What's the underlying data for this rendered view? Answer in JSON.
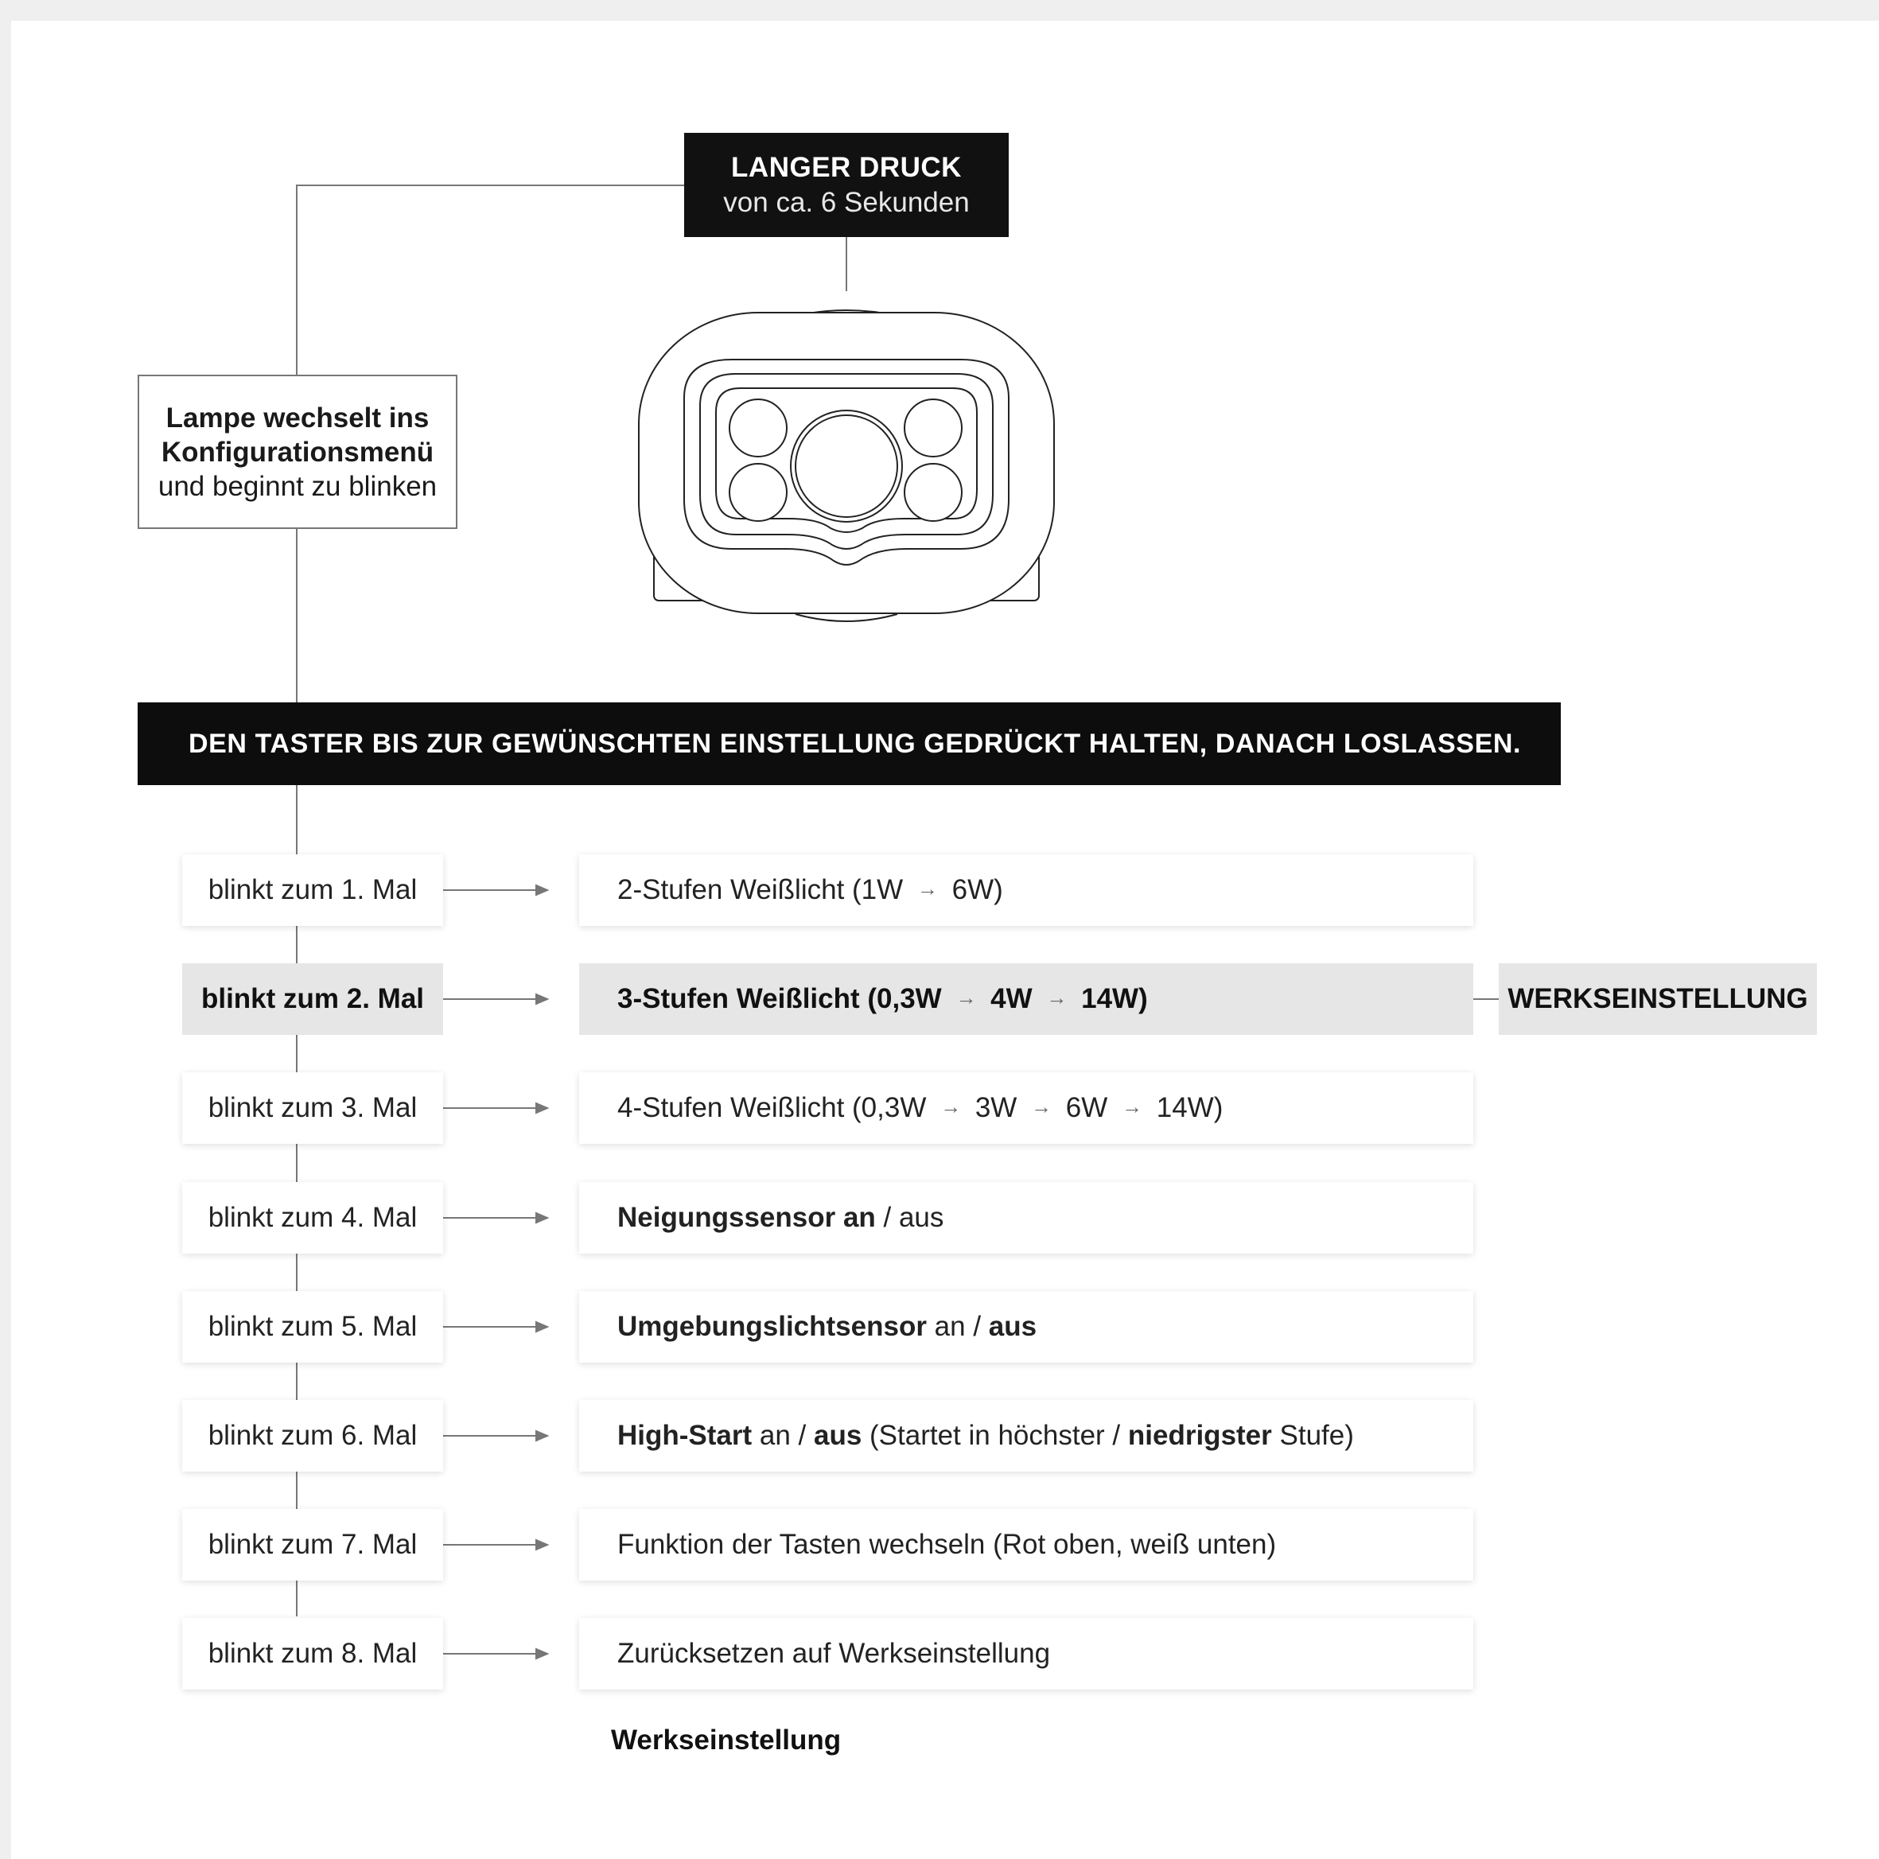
{
  "press": {
    "title": "LANGER DRUCK",
    "subtitle": "von ca. 6 Sekunden"
  },
  "config": {
    "line1": "Lampe wechselt ins",
    "line2": "Konfigurationsmenü",
    "line3": "und beginnt zu blinken"
  },
  "banner": "DEN TASTER BIS ZUR GEWÜNSCHTEN EINSTELLUNG GEDRÜCKT HALTEN, DANACH LOSLASSEN.",
  "arrow_glyph": "→",
  "rows": [
    {
      "blink": "blinkt zum 1. Mal",
      "result": [
        [
          "2-Stufen Weißlicht (1W ",
          false
        ],
        [
          "arrow",
          false
        ],
        [
          " 6W)",
          false
        ]
      ]
    },
    {
      "blink": "blinkt zum 2. Mal",
      "highlight": true,
      "tag": "WERKSEINSTELLUNG",
      "result": [
        [
          "3-Stufen Weißlicht (0,3W ",
          true
        ],
        [
          "arrow",
          true
        ],
        [
          " 4W ",
          true
        ],
        [
          "arrow",
          true
        ],
        [
          " 14W)",
          true
        ]
      ]
    },
    {
      "blink": "blinkt zum 3. Mal",
      "result": [
        [
          "4-Stufen Weißlicht (0,3W ",
          false
        ],
        [
          "arrow",
          false
        ],
        [
          " 3W ",
          false
        ],
        [
          "arrow",
          false
        ],
        [
          " 6W ",
          false
        ],
        [
          "arrow",
          false
        ],
        [
          " 14W)",
          false
        ]
      ]
    },
    {
      "blink": "blinkt zum 4. Mal",
      "result": [
        [
          "Neigungssensor an",
          true
        ],
        [
          " / aus",
          false
        ]
      ]
    },
    {
      "blink": "blinkt zum 5. Mal",
      "result": [
        [
          "Umgebungslichtsensor",
          true
        ],
        [
          " an / ",
          false
        ],
        [
          "aus",
          true
        ]
      ]
    },
    {
      "blink": "blinkt zum 6. Mal",
      "result": [
        [
          "High-Start",
          true
        ],
        [
          " an / ",
          false
        ],
        [
          "aus",
          true
        ],
        [
          " (Startet in höchster / ",
          false
        ],
        [
          "niedrigster",
          true
        ],
        [
          " Stufe)",
          false
        ]
      ]
    },
    {
      "blink": "blinkt zum 7. Mal",
      "result": [
        [
          "Funktion der Tasten wechseln (Rot oben, weiß unten)",
          false
        ]
      ]
    },
    {
      "blink": "blinkt zum 8. Mal",
      "result": [
        [
          "Zurücksetzen auf Werkseinstellung",
          false
        ]
      ]
    }
  ],
  "legend": "Werkseinstellung",
  "colors": {
    "banner_bg": "#0d0d0d",
    "highlight_bg": "#e6e6e6",
    "line": "#777777"
  }
}
